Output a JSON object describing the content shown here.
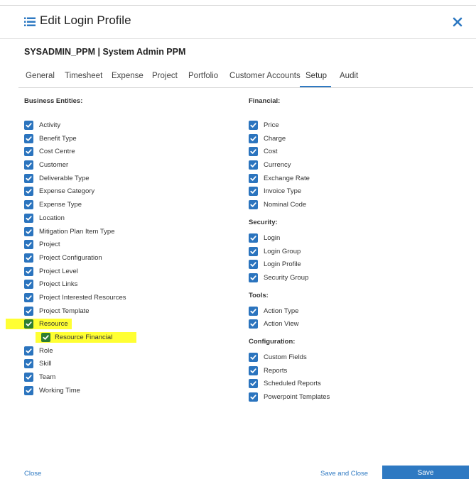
{
  "dialog": {
    "title": "Edit Login Profile",
    "subtitle": "SYSADMIN_PPM | System Admin PPM"
  },
  "tabs": [
    {
      "label": "General"
    },
    {
      "label": "Timesheet"
    },
    {
      "label": "Expense"
    },
    {
      "label": "Project"
    },
    {
      "label": "Portfolio"
    },
    {
      "label": "Customer Accounts"
    },
    {
      "label": "Setup"
    },
    {
      "label": "Audit"
    }
  ],
  "active_tab": "Setup",
  "left_column": {
    "title": "Business Entities:",
    "items": [
      "Activity",
      "Benefit Type",
      "Cost Centre",
      "Customer",
      "Deliverable Type",
      "Expense Category",
      "Expense Type",
      "Location",
      "Mitigation Plan Item Type",
      "Project",
      "Project Configuration",
      "Project Level",
      "Project Links",
      "Project Interested Resources",
      "Project Template",
      "Resource",
      "Resource Financial",
      "Role",
      "Skill",
      "Team",
      "Working Time"
    ]
  },
  "right_column": {
    "financial": {
      "title": "Financial:",
      "items": [
        "Price",
        "Charge",
        "Cost",
        "Currency",
        "Exchange Rate",
        "Invoice Type",
        "Nominal Code"
      ]
    },
    "security": {
      "title": "Security:",
      "items": [
        "Login",
        "Login Group",
        "Login Profile",
        "Security Group"
      ]
    },
    "tools": {
      "title": "Tools:",
      "items": [
        "Action Type",
        "Action View"
      ]
    },
    "configuration": {
      "title": "Configuration:",
      "items": [
        "Custom Fields",
        "Reports",
        "Scheduled Reports",
        "Powerpoint Templates"
      ]
    }
  },
  "footer": {
    "close_label": "Close",
    "save_and_close_label": "Save and Close",
    "save_label": "Save"
  },
  "colors": {
    "accent": "#2e79c2",
    "checkbox": "#2b74be",
    "highlight": "#ffff33"
  },
  "icons": {
    "title_icon": "list-icon",
    "close_icon": "close-icon",
    "checkbox_icon": "checkmark-icon"
  }
}
